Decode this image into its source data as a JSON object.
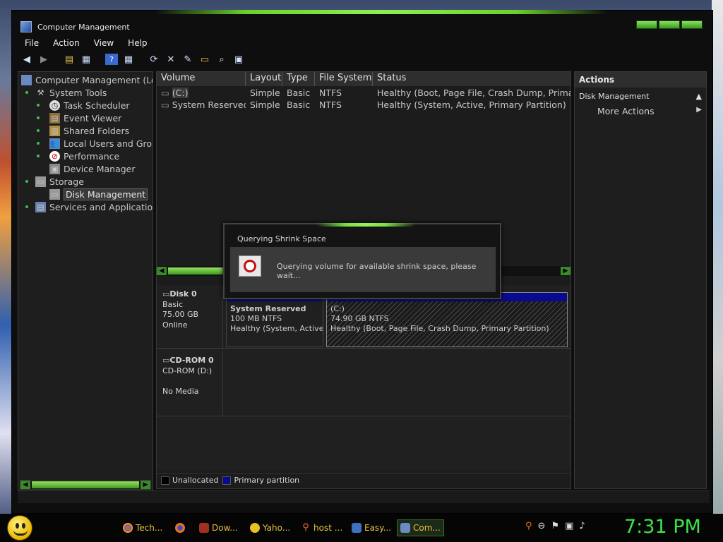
{
  "window": {
    "title": "Computer Management"
  },
  "menu": [
    "File",
    "Action",
    "View",
    "Help"
  ],
  "toolbar_icons": [
    "back-icon",
    "forward-icon",
    "up-folder-icon",
    "show-hide-tree-icon",
    "help-icon",
    "properties-icon",
    "refresh-icon",
    "delete-icon",
    "export-icon",
    "open-folder-icon",
    "search-icon",
    "console-icon"
  ],
  "tree": {
    "root": "Computer Management (Loc",
    "system_tools": "System Tools",
    "task_scheduler": "Task Scheduler",
    "event_viewer": "Event Viewer",
    "shared_folders": "Shared Folders",
    "local_users": "Local Users and Grou",
    "performance": "Performance",
    "device_manager": "Device Manager",
    "storage": "Storage",
    "disk_management": "Disk Management",
    "services": "Services and Applications"
  },
  "volumes": {
    "headers": [
      "Volume",
      "Layout",
      "Type",
      "File System",
      "Status"
    ],
    "rows": [
      [
        "(C:)",
        "Simple",
        "Basic",
        "NTFS",
        "Healthy (Boot, Page File, Crash Dump, Primary"
      ],
      [
        "System Reserved",
        "Simple",
        "Basic",
        "NTFS",
        "Healthy (System, Active, Primary Partition)"
      ]
    ]
  },
  "disks": {
    "disk0": {
      "name": "Disk 0",
      "type": "Basic",
      "size": "75.00 GB",
      "state": "Online"
    },
    "part1": {
      "name": "System Reserved",
      "size": "100 MB NTFS",
      "status": "Healthy (System, Active, P"
    },
    "part2": {
      "name": "(C:)",
      "size": "74.90 GB NTFS",
      "status": "Healthy (Boot, Page File, Crash Dump, Primary Partition)"
    },
    "cdrom": {
      "name": "CD-ROM 0",
      "type": "CD-ROM (D:)",
      "state": "No Media"
    }
  },
  "legend": {
    "unallocated": "Unallocated",
    "primary": "Primary partition",
    "unallocated_color": "#000000",
    "primary_color": "#0a0a90"
  },
  "actions": {
    "header": "Actions",
    "section": "Disk Management",
    "more": "More Actions"
  },
  "dialog": {
    "title": "Querying Shrink Space",
    "message": "Querying volume for available shrink space, please wait..."
  },
  "taskbar": {
    "items": [
      "Tech...",
      "",
      "Dow...",
      "Yaho...",
      "host ...",
      "Easy...",
      "Com..."
    ],
    "clock": "7:31 PM"
  }
}
